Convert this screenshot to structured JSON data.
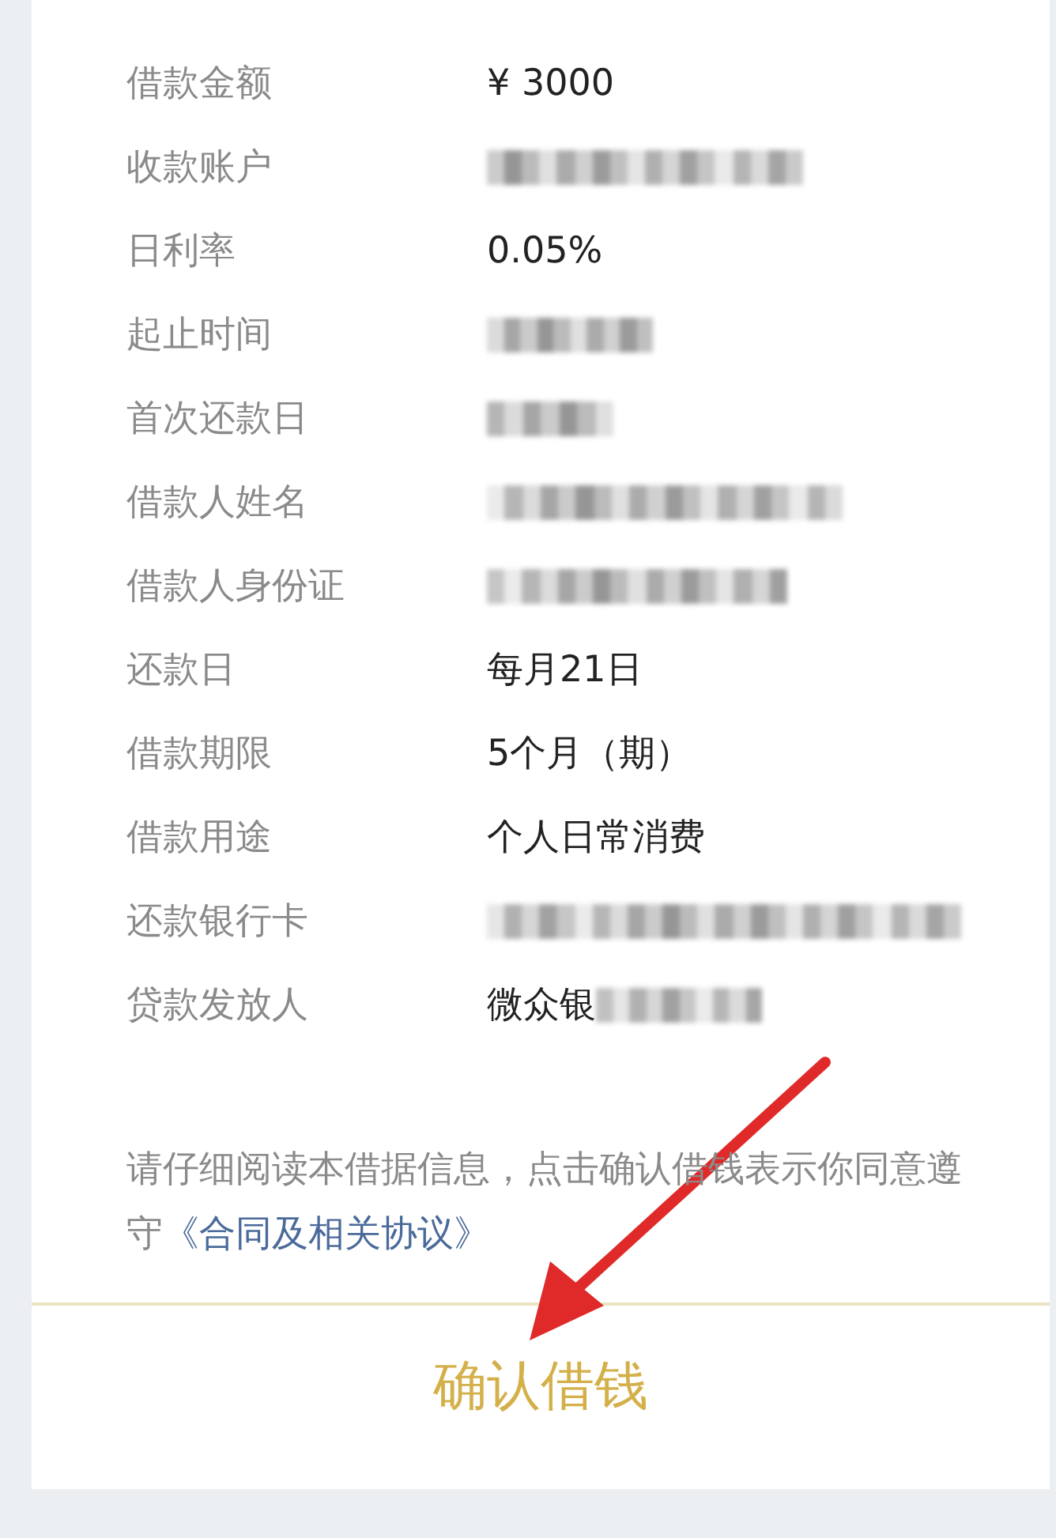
{
  "details": [
    {
      "label": "借款金额",
      "value": "¥ 3000",
      "blurred": false
    },
    {
      "label": "收款账户",
      "blurred": true
    },
    {
      "label": "日利率",
      "value": "0.05%",
      "blurred": false
    },
    {
      "label": "起止时间",
      "blurred": true
    },
    {
      "label": "首次还款日",
      "blurred": true
    },
    {
      "label": "借款人姓名",
      "blurred": true
    },
    {
      "label": "借款人身份证",
      "blurred": true
    },
    {
      "label": "还款日",
      "value": "每月21日",
      "blurred": false
    },
    {
      "label": "借款期限",
      "value": "5个月（期）",
      "blurred": false
    },
    {
      "label": "借款用途",
      "value": "个人日常消费",
      "blurred": false
    },
    {
      "label": "还款银行卡",
      "blurred": true
    },
    {
      "label": "贷款发放人",
      "value": "微众银",
      "blurred": true
    }
  ],
  "notice": {
    "text": "请仔细阅读本借据信息，点击确认借钱表示你同意遵守",
    "link": "《合同及相关协议》"
  },
  "confirm_button": "确认借钱"
}
